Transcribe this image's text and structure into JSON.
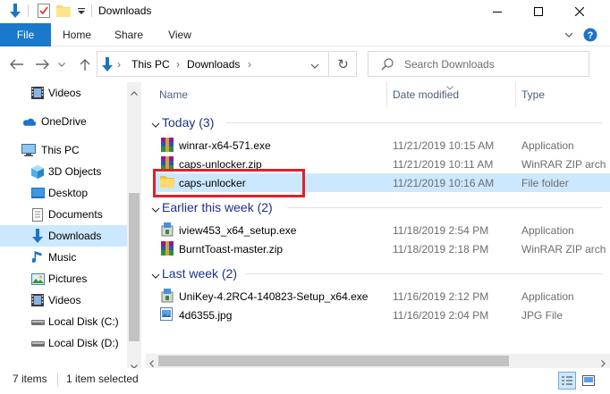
{
  "window": {
    "title": "Downloads",
    "minimize_glyph": "—",
    "maximize_glyph": "☐",
    "close_glyph": "✕"
  },
  "ribbon": {
    "tabs": [
      "File",
      "Home",
      "Share",
      "View"
    ],
    "expand_glyph": "⌄",
    "help_glyph": "?"
  },
  "address": {
    "breadcrumb": [
      "This PC",
      "Downloads"
    ],
    "separator": "›",
    "dropdown_glyph": "⌄",
    "refresh_glyph": "↻",
    "search_placeholder": "Search Downloads"
  },
  "nav_pane": {
    "items": [
      {
        "label": "Videos",
        "icon": "videos-icon",
        "selected": false
      },
      {
        "label": "OneDrive",
        "icon": "onedrive-icon",
        "selected": false
      },
      {
        "label": "This PC",
        "icon": "this-pc-icon",
        "selected": false
      },
      {
        "label": "3D Objects",
        "icon": "3d-objects-icon",
        "selected": false
      },
      {
        "label": "Desktop",
        "icon": "desktop-icon",
        "selected": false
      },
      {
        "label": "Documents",
        "icon": "documents-icon",
        "selected": false
      },
      {
        "label": "Downloads",
        "icon": "downloads-icon",
        "selected": true
      },
      {
        "label": "Music",
        "icon": "music-icon",
        "selected": false
      },
      {
        "label": "Pictures",
        "icon": "pictures-icon",
        "selected": false
      },
      {
        "label": "Videos",
        "icon": "videos-icon",
        "selected": false
      },
      {
        "label": "Local Disk (C:)",
        "icon": "drive-icon",
        "selected": false
      },
      {
        "label": "Local Disk (D:)",
        "icon": "drive-icon",
        "selected": false
      }
    ]
  },
  "columns": {
    "name": "Name",
    "date_modified": "Date modified",
    "type": "Type"
  },
  "groups": [
    {
      "label": "Today (3)",
      "files": [
        {
          "name": "winrar-x64-571.exe",
          "date": "11/21/2019 10:15 AM",
          "type": "Application",
          "icon": "winrar-exe-icon",
          "selected": false
        },
        {
          "name": "caps-unlocker.zip",
          "date": "11/21/2019 10:11 AM",
          "type": "WinRAR ZIP arch",
          "icon": "zip-archive-icon",
          "selected": false
        },
        {
          "name": "caps-unlocker",
          "date": "11/21/2019 10:16 AM",
          "type": "File folder",
          "icon": "folder-icon",
          "selected": true
        }
      ]
    },
    {
      "label": "Earlier this week (2)",
      "files": [
        {
          "name": "iview453_x64_setup.exe",
          "date": "11/18/2019 2:54 PM",
          "type": "Application",
          "icon": "installer-icon",
          "selected": false
        },
        {
          "name": "BurntToast-master.zip",
          "date": "11/18/2019 2:18 PM",
          "type": "WinRAR ZIP arch",
          "icon": "zip-archive-icon",
          "selected": false
        }
      ]
    },
    {
      "label": "Last week (2)",
      "files": [
        {
          "name": "UniKey-4.2RC4-140823-Setup_x64.exe",
          "date": "11/16/2019 2:12 PM",
          "type": "Application",
          "icon": "installer-icon",
          "selected": false
        },
        {
          "name": "4d6355.jpg",
          "date": "11/16/2019 2:04 PM",
          "type": "JPG File",
          "icon": "image-file-icon",
          "selected": false
        }
      ]
    }
  ],
  "status": {
    "item_count": "7 items",
    "selection": "1 item selected"
  },
  "colors": {
    "accent": "#1979ca",
    "selection": "#cce8ff",
    "group_header": "#1e3287",
    "highlight_box": "#e0202a"
  }
}
